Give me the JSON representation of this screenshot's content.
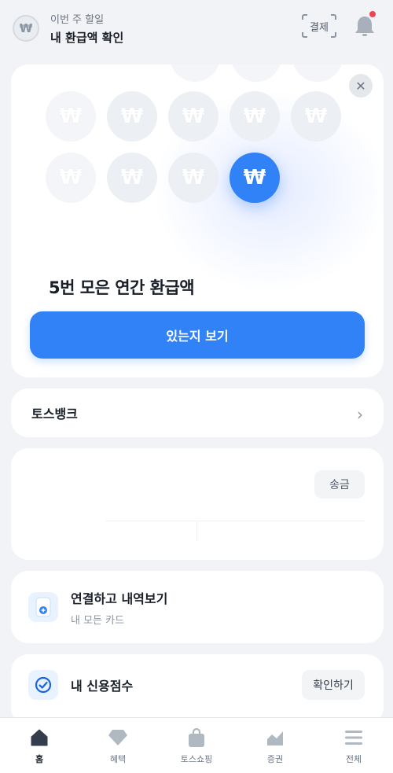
{
  "header": {
    "subtitle": "이번 주 할일",
    "title": "내 환급액 확인",
    "logo_glyph": "₩",
    "pay_label": "결제",
    "notification_dot_color": "#f04452"
  },
  "hero": {
    "coin_glyph": "₩",
    "close_glyph": "✕",
    "headline": "5번 모은 연간 환급액",
    "button_label": "있는지 보기",
    "accent_color": "#3182f6"
  },
  "bank": {
    "label": "토스뱅크",
    "chevron": "›"
  },
  "account": {
    "send_label": "송금"
  },
  "cards": {
    "title": "연결하고 내역보기",
    "subtitle": "내 모든 카드"
  },
  "credit": {
    "title": "내 신용점수",
    "button_label": "확인하기"
  },
  "bottom_nav": {
    "items": [
      {
        "label": "홈",
        "icon": "home-icon",
        "active": true
      },
      {
        "label": "혜택",
        "icon": "diamond-icon",
        "active": false
      },
      {
        "label": "토스쇼핑",
        "icon": "shopping-bag-icon",
        "active": false
      },
      {
        "label": "증권",
        "icon": "chart-icon",
        "active": false
      },
      {
        "label": "전체",
        "icon": "menu-icon",
        "active": false
      }
    ]
  }
}
